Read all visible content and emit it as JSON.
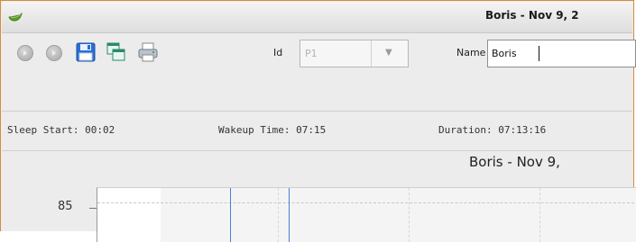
{
  "window": {
    "title": "Boris - Nov 9, 2"
  },
  "toolbar": {
    "buttons": [
      {
        "name": "back-button",
        "icon": "circle-back-icon"
      },
      {
        "name": "forward-button",
        "icon": "circle-forward-icon"
      },
      {
        "name": "save-button",
        "icon": "floppy-disk-icon"
      },
      {
        "name": "copy-button",
        "icon": "copy-windows-icon"
      },
      {
        "name": "print-button",
        "icon": "printer-icon"
      }
    ],
    "id_label": "Id",
    "id_value": "P1",
    "name_label": "Name",
    "name_value": "Boris"
  },
  "status": {
    "sleep_start": "Sleep Start: 00:02",
    "wakeup_time": "Wakeup Time: 07:15",
    "duration": "Duration: 07:13:16"
  },
  "chart": {
    "title": "Boris - Nov 9,",
    "y_tick_label": "85"
  },
  "colors": {
    "window_border": "#d98a3a",
    "event_line": "#4a7fd8",
    "save_icon": "#2a6fd6"
  }
}
